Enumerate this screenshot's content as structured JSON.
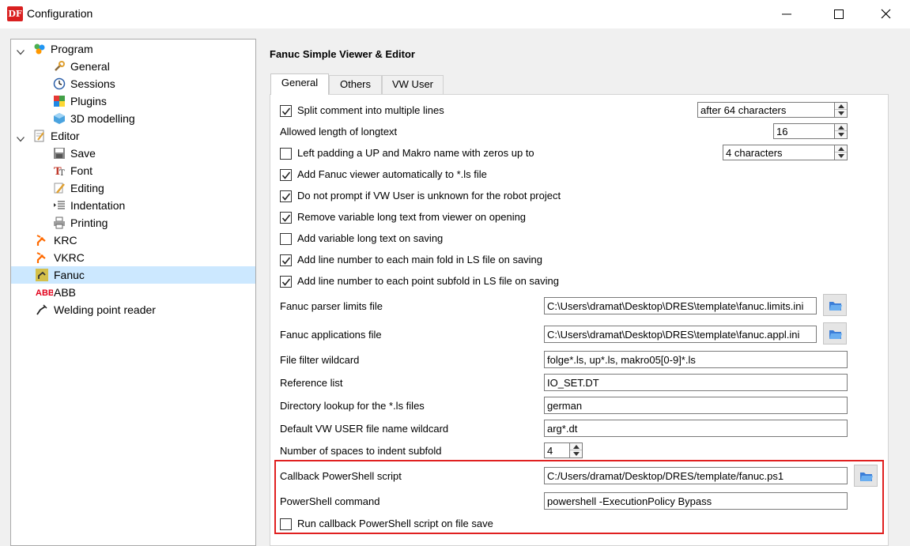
{
  "window": {
    "title": "Configuration",
    "icon_text": "DF",
    "controls": {
      "minimize": "minimize-icon",
      "maximize": "maximize-icon",
      "close": "close-icon"
    }
  },
  "tree": {
    "items": [
      {
        "label": "Program",
        "icon": "program-icon",
        "expanded": true
      },
      {
        "label": "General",
        "icon": "wrench-icon"
      },
      {
        "label": "Sessions",
        "icon": "clock-icon"
      },
      {
        "label": "Plugins",
        "icon": "plugins-icon"
      },
      {
        "label": "3D modelling",
        "icon": "cube-icon"
      },
      {
        "label": "Editor",
        "icon": "editor-icon",
        "expanded": true
      },
      {
        "label": "Save",
        "icon": "save-icon"
      },
      {
        "label": "Font",
        "icon": "font-icon"
      },
      {
        "label": "Editing",
        "icon": "pencil-icon"
      },
      {
        "label": "Indentation",
        "icon": "indent-icon"
      },
      {
        "label": "Printing",
        "icon": "printer-icon"
      },
      {
        "label": "KRC",
        "icon": "robot-arm-icon"
      },
      {
        "label": "VKRC",
        "icon": "robot-arm-icon"
      },
      {
        "label": "Fanuc",
        "icon": "fanuc-icon",
        "selected": true
      },
      {
        "label": "ABB",
        "icon": "abb-logo-icon"
      },
      {
        "label": "Welding point reader",
        "icon": "welding-icon"
      }
    ]
  },
  "panel": {
    "title": "Fanuc Simple Viewer & Editor",
    "tabs": [
      {
        "label": "General",
        "active": true
      },
      {
        "label": "Others",
        "active": false
      },
      {
        "label": "VW User",
        "active": false
      }
    ]
  },
  "settings": {
    "split_comment": {
      "label": "Split comment into multiple lines",
      "checked": true,
      "value": "after 64 characters"
    },
    "longtext_length": {
      "label": "Allowed length of longtext",
      "value": "16"
    },
    "left_padding": {
      "label": "Left padding a UP and Makro name with zeros up to",
      "checked": false,
      "value": "4 characters"
    },
    "add_viewer": {
      "label": "Add Fanuc viewer automatically to *.ls file",
      "checked": true
    },
    "no_prompt": {
      "label": "Do not prompt if VW User is unknown for the robot project",
      "checked": true
    },
    "remove_longtext": {
      "label": "Remove variable long text from viewer on opening",
      "checked": true
    },
    "add_longtext": {
      "label": "Add variable long text on saving",
      "checked": false
    },
    "line_main_fold": {
      "label": "Add line number to each main fold in LS file on saving",
      "checked": true
    },
    "line_point_subfold": {
      "label": "Add line number to each point subfold in LS file on saving",
      "checked": true
    },
    "parser_limits": {
      "label": "Fanuc parser limits file",
      "value": "C:\\Users\\dramat\\Desktop\\DRES\\template\\fanuc.limits.ini"
    },
    "applications": {
      "label": "Fanuc applications file",
      "value": "C:\\Users\\dramat\\Desktop\\DRES\\template\\fanuc.appl.ini"
    },
    "file_filter": {
      "label": "File filter wildcard",
      "value": "folge*.ls, up*.ls, makro05[0-9]*.ls"
    },
    "reference_list": {
      "label": "Reference list",
      "value": "IO_SET.DT"
    },
    "directory_lookup": {
      "label": "Directory lookup for the *.ls files",
      "value": "german"
    },
    "vw_user_wildcard": {
      "label": "Default VW USER file name wildcard",
      "value": "arg*.dt"
    },
    "indent_spaces": {
      "label": "Number of spaces to indent subfold",
      "value": "4"
    },
    "callback_script": {
      "label": "Callback PowerShell script",
      "value": "C:/Users/dramat/Desktop/DRES/template/fanuc.ps1"
    },
    "powershell_command": {
      "label": "PowerShell command",
      "value": "powershell -ExecutionPolicy Bypass"
    },
    "run_callback": {
      "label": "Run callback PowerShell script on file save",
      "checked": false
    }
  },
  "colors": {
    "selection": "#cce8ff",
    "highlight_border": "#e02020",
    "app_icon": "#d92020"
  }
}
